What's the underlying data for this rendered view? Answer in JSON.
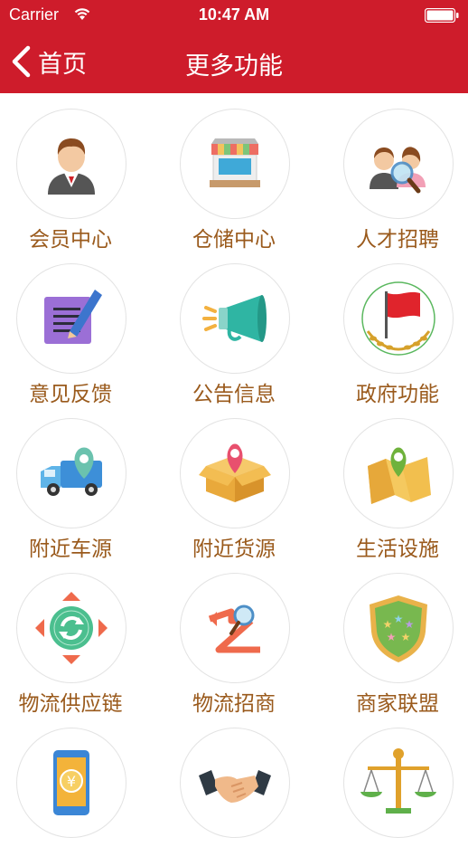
{
  "status_bar": {
    "carrier": "Carrier",
    "time": "10:47 AM"
  },
  "nav": {
    "back_label": "首页",
    "title": "更多功能"
  },
  "colors": {
    "header": "#ce1c2b",
    "label": "#9a5a1c",
    "circle_border": "#e3e3e3"
  },
  "grid": {
    "items": [
      {
        "label": "会员中心",
        "icon": "member-avatar-icon"
      },
      {
        "label": "仓储中心",
        "icon": "storefront-icon"
      },
      {
        "label": "人才招聘",
        "icon": "recruit-magnifier-icon"
      },
      {
        "label": "意见反馈",
        "icon": "feedback-pencil-icon"
      },
      {
        "label": "公告信息",
        "icon": "megaphone-icon"
      },
      {
        "label": "政府功能",
        "icon": "red-flag-laurel-icon"
      },
      {
        "label": "附近车源",
        "icon": "truck-location-icon"
      },
      {
        "label": "附近货源",
        "icon": "box-location-icon"
      },
      {
        "label": "生活设施",
        "icon": "map-pin-icon"
      },
      {
        "label": "物流供应链",
        "icon": "cycle-diamond-icon"
      },
      {
        "label": "物流招商",
        "icon": "z-magnifier-icon"
      },
      {
        "label": "商家联盟",
        "icon": "shield-stars-icon"
      },
      {
        "label": "",
        "icon": "phone-yuan-icon"
      },
      {
        "label": "",
        "icon": "handshake-icon"
      },
      {
        "label": "",
        "icon": "scales-icon"
      }
    ]
  }
}
